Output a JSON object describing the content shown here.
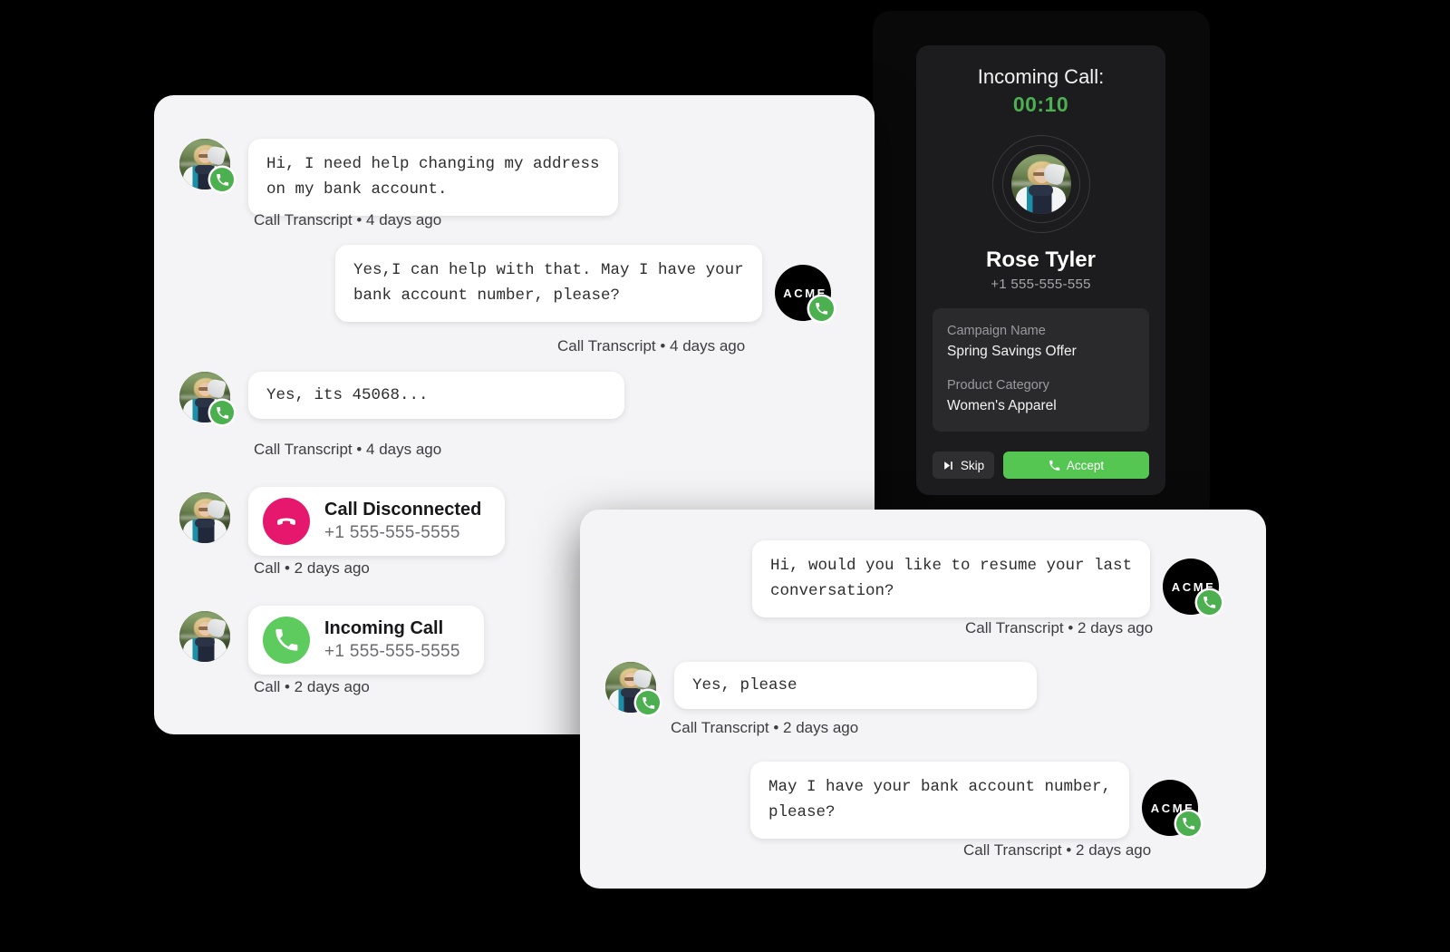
{
  "background_color": "#000000",
  "panel_color": "#f4f4f6",
  "bubble_color": "#ffffff",
  "accent_green": "#4caf50",
  "accent_pink": "#e5186e",
  "brand": {
    "logo_text": "ACME"
  },
  "left_panel": {
    "messages": [
      {
        "sender": "customer",
        "text": "Hi, I need help changing my address\non my bank account.",
        "meta": "Call Transcript • 4 days ago"
      },
      {
        "sender": "agent",
        "text": "Yes,I can help with that. May I have your\nbank account number, please?",
        "meta": "Call Transcript • 4 days ago"
      },
      {
        "sender": "customer",
        "text": "Yes, its 45068...",
        "meta": "Call Transcript • 4 days ago"
      }
    ],
    "events": [
      {
        "icon": "phone-down-icon",
        "icon_color": "#e5186e",
        "title": "Call Disconnected",
        "phone": "+1 555-555-5555",
        "meta": "Call • 2 days ago"
      },
      {
        "icon": "phone-icon",
        "icon_color": "#5dcb5d",
        "title": "Incoming Call",
        "phone": "+1 555-555-5555",
        "meta": "Call • 2 days ago"
      }
    ]
  },
  "right_panel": {
    "messages": [
      {
        "sender": "agent",
        "text": "Hi, would you like to resume your last\nconversation?",
        "meta": "Call Transcript • 2 days ago"
      },
      {
        "sender": "customer",
        "text": "Yes, please",
        "meta": "Call Transcript • 2 days ago"
      },
      {
        "sender": "agent",
        "text": "May I have your bank account number,\nplease?",
        "meta": "Call Transcript • 2 days ago"
      }
    ]
  },
  "incoming_call": {
    "title": "Incoming Call:",
    "timer": "00:10",
    "timer_color": "#4caf50",
    "caller_name": "Rose Tyler",
    "caller_phone": "+1 555-555-555",
    "info": [
      {
        "label": "Campaign Name",
        "value": "Spring Savings Offer"
      },
      {
        "label": "Product Category",
        "value": "Women's Apparel"
      }
    ],
    "skip_button": "Skip",
    "accept_button": "Accept"
  }
}
